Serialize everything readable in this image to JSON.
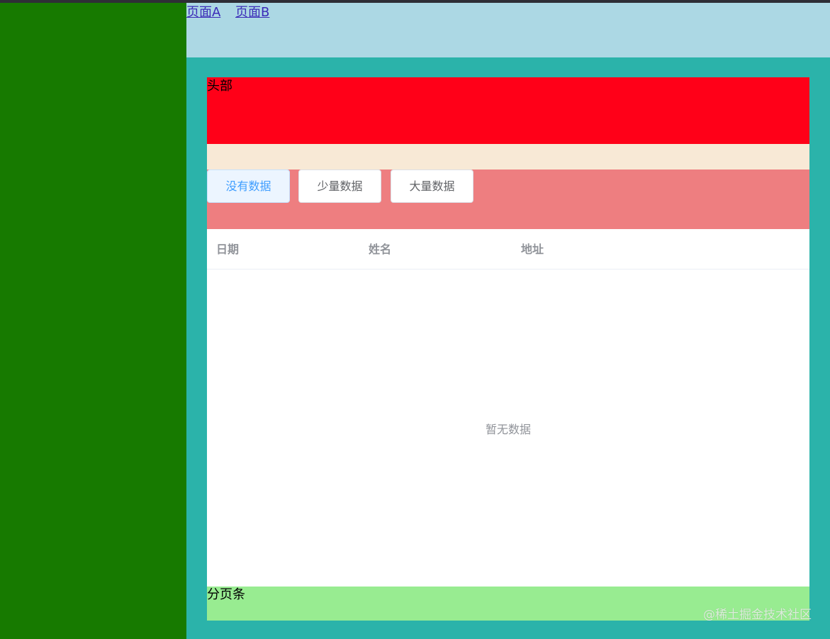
{
  "nav": {
    "links": [
      "页面A",
      "页面B"
    ]
  },
  "panel": {
    "head_label": "头部",
    "buttons": [
      {
        "label": "没有数据",
        "active": true
      },
      {
        "label": "少量数据",
        "active": false
      },
      {
        "label": "大量数据",
        "active": false
      }
    ],
    "table": {
      "columns": [
        "日期",
        "姓名",
        "地址"
      ],
      "empty_text": "暂无数据"
    },
    "pager_label": "分页条"
  },
  "watermark": "@稀土掘金技术社区",
  "colors": {
    "sidebar": "#177a00",
    "navbar": "#acd8e4",
    "content": "#2bb3aa",
    "head": "#ff0018",
    "beige": "#f8e9d6",
    "button_area": "#ee7e80",
    "pager": "#98ec91",
    "active_button_text": "#409eff"
  }
}
